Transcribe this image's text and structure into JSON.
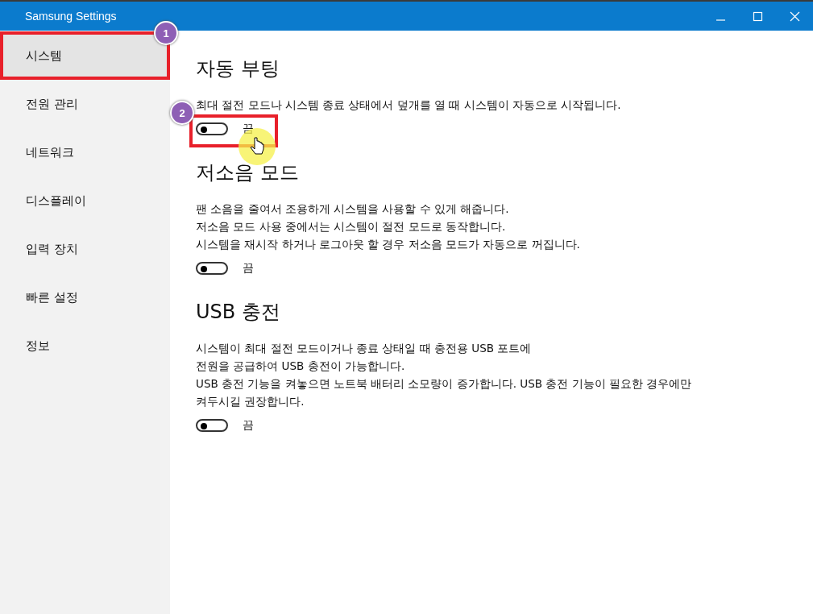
{
  "window": {
    "title": "Samsung Settings"
  },
  "sidebar": {
    "items": [
      {
        "label": "시스템",
        "selected": true,
        "annotation": "1"
      },
      {
        "label": "전원 관리",
        "selected": false
      },
      {
        "label": "네트워크",
        "selected": false
      },
      {
        "label": "디스플레이",
        "selected": false
      },
      {
        "label": "입력 장치",
        "selected": false
      },
      {
        "label": "빠른 설정",
        "selected": false
      },
      {
        "label": "정보",
        "selected": false
      }
    ]
  },
  "sections": [
    {
      "title": "자동 부팅",
      "description": [
        "최대 절전 모드나 시스템 종료 상태에서 덮개를 열 때 시스템이 자동으로 시작됩니다."
      ],
      "toggle": {
        "on": false,
        "state_label": "끔",
        "annotation": "2",
        "pointer": true
      }
    },
    {
      "title": "저소음 모드",
      "description": [
        "팬 소음을 줄여서 조용하게 시스템을 사용할 수 있게 해줍니다.",
        "저소음 모드 사용 중에서는 시스템이 절전 모드로 동작합니다.",
        "시스템을 재시작 하거나 로그아웃 할 경우 저소음 모드가 자동으로 꺼집니다."
      ],
      "toggle": {
        "on": false,
        "state_label": "끔"
      }
    },
    {
      "title": "USB 충전",
      "description": [
        "시스템이 최대 절전 모드이거나 종료 상태일 때 충전용 USB 포트에",
        "전원을 공급하여 USB 충전이 가능합니다.",
        "USB 충전 기능을 켜놓으면 노트북 배터리 소모량이 증가합니다. USB 충전 기능이 필요한 경우에만",
        "켜두시길 권장합니다."
      ],
      "toggle": {
        "on": false,
        "state_label": "끔"
      }
    }
  ]
}
